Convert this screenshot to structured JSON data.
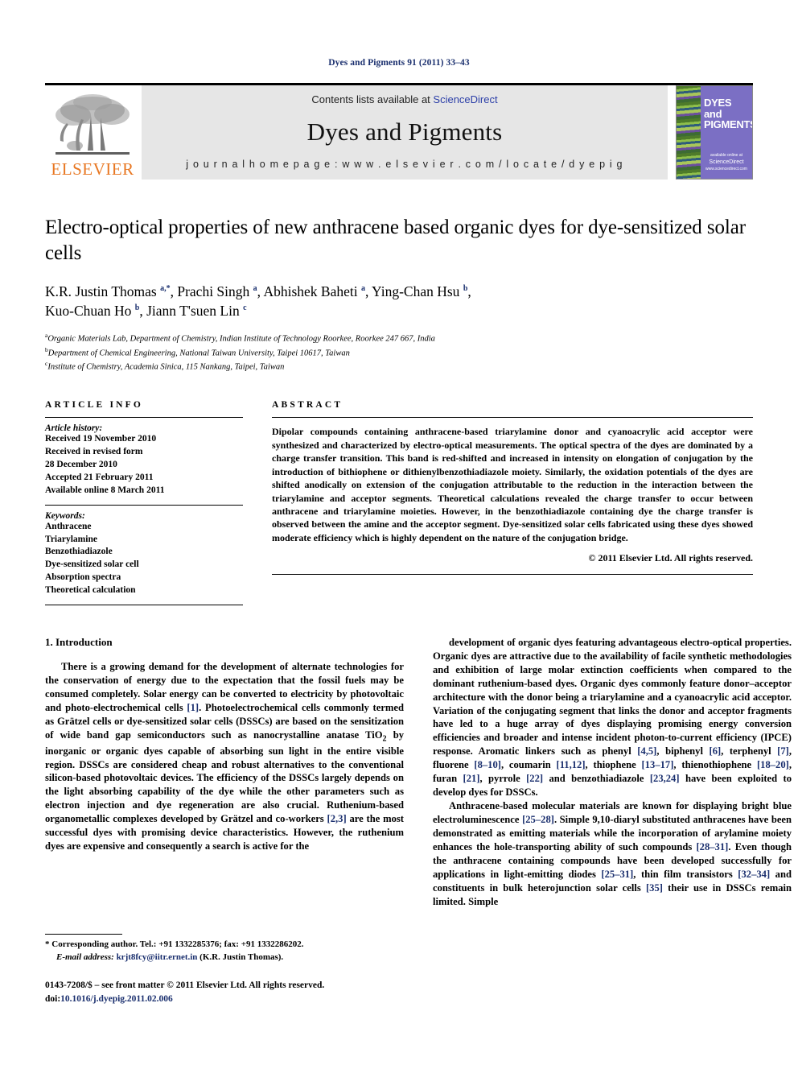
{
  "running_head": "Dyes and Pigments 91 (2011) 33–43",
  "masthead": {
    "publisher": "ELSEVIER",
    "contents_prefix": "Contents lists available at ",
    "contents_link": "ScienceDirect",
    "journal_title": "Dyes and Pigments",
    "homepage": "j o u r n a l   h o m e p a g e :   w w w . e l s e v i e r . c o m / l o c a t e / d y e p i g",
    "cover": {
      "line1": "DYES",
      "line2": "and",
      "line3": "PIGMENTS",
      "foot1": "available online at",
      "foot2": "ScienceDirect",
      "foot3": "www.sciencedirect.com",
      "bg_color": "#7b6fc4"
    }
  },
  "title": "Electro-optical properties of new anthracene based organic dyes for dye-sensitized solar cells",
  "authors_line1_html": "K.R. Justin Thomas <sup>a,*</sup>, Prachi Singh <sup>a</sup>, Abhishek Baheti <sup>a</sup>, Ying-Chan Hsu <sup>b</sup>,",
  "authors_line2_html": "Kuo-Chuan Ho <sup>b</sup>, Jiann T'suen Lin <sup>c</sup>",
  "affiliations": [
    {
      "mark": "a",
      "text": "Organic Materials Lab, Department of Chemistry, Indian Institute of Technology Roorkee, Roorkee 247 667, India"
    },
    {
      "mark": "b",
      "text": "Department of Chemical Engineering, National Taiwan University, Taipei 10617, Taiwan"
    },
    {
      "mark": "c",
      "text": "Institute of Chemistry, Academia Sinica, 115 Nankang, Taipei, Taiwan"
    }
  ],
  "article_info": {
    "heading": "ARTICLE INFO",
    "history_label": "Article history:",
    "history": [
      "Received 19 November 2010",
      "Received in revised form",
      "28 December 2010",
      "Accepted 21 February 2011",
      "Available online 8 March 2011"
    ],
    "keywords_label": "Keywords:",
    "keywords": [
      "Anthracene",
      "Triarylamine",
      "Benzothiadiazole",
      "Dye-sensitized solar cell",
      "Absorption spectra",
      "Theoretical calculation"
    ]
  },
  "abstract": {
    "heading": "ABSTRACT",
    "text": "Dipolar compounds containing anthracene-based triarylamine donor and cyanoacrylic acid acceptor were synthesized and characterized by electro-optical measurements. The optical spectra of the dyes are dominated by a charge transfer transition. This band is red-shifted and increased in intensity on elongation of conjugation by the introduction of bithiophene or dithienylbenzothiadiazole moiety. Similarly, the oxidation potentials of the dyes are shifted anodically on extension of the conjugation attributable to the reduction in the interaction between the triarylamine and acceptor segments. Theoretical calculations revealed the charge transfer to occur between anthracene and triarylamine moieties. However, in the benzothiadiazole containing dye the charge transfer is observed between the amine and the acceptor segment. Dye-sensitized solar cells fabricated using these dyes showed moderate efficiency which is highly dependent on the nature of the conjugation bridge.",
    "copyright": "© 2011 Elsevier Ltd. All rights reserved."
  },
  "body": {
    "section_number_title": "1. Introduction",
    "left_paragraph_1_html": "There is a growing demand for the development of alternate technologies for the conservation of energy due to the expectation that the fossil fuels may be consumed completely. Solar energy can be converted to electricity by photovoltaic and photo-electrochemical cells <span class=\"ref\">[1]</span>. Photoelectrochemical cells commonly termed as Gr&#228;tzel cells or dye-sensitized solar cells (DSSCs) are based on the sensitization of wide band gap semiconductors such as nanocrystalline anatase TiO<sub>2</sub> by inorganic or organic dyes capable of absorbing sun light in the entire visible region. DSSCs are considered cheap and robust alternatives to the conventional silicon-based photovoltaic devices. The efficiency of the DSSCs largely depends on the light absorbing capability of the dye while the other parameters such as electron injection and dye regeneration are also crucial. Ruthenium-based organometallic complexes developed by Gr&#228;tzel and co-workers <span class=\"ref\">[2,3]</span> are the most successful dyes with promising device characteristics. However, the ruthenium dyes are expensive and consequently a search is active for the",
    "right_paragraph_1_html": "development of organic dyes featuring advantageous electro-optical properties. Organic dyes are attractive due to the availability of facile synthetic methodologies and exhibition of large molar extinction coefficients when compared to the dominant ruthenium-based dyes. Organic dyes commonly feature donor&#8211;acceptor architecture with the donor being a triarylamine and a cyanoacrylic acid acceptor. Variation of the conjugating segment that links the donor and acceptor fragments have led to a huge array of dyes displaying promising energy conversion efficiencies and broader and intense incident photon-to-current efficiency (IPCE) response. Aromatic linkers such as phenyl <span class=\"ref\">[4,5]</span>, biphenyl <span class=\"ref\">[6]</span>, terphenyl <span class=\"ref\">[7]</span>, fluorene <span class=\"ref\">[8&#8211;10]</span>, coumarin <span class=\"ref\">[11,12]</span>, thiophene <span class=\"ref\">[13&#8211;17]</span>, thienothiophene <span class=\"ref\">[18&#8211;20]</span>, furan <span class=\"ref\">[21]</span>, pyrrole <span class=\"ref\">[22]</span> and benzothiadiazole <span class=\"ref\">[23,24]</span> have been exploited to develop dyes for DSSCs.",
    "right_paragraph_2_html": "Anthracene-based molecular materials are known for displaying bright blue electroluminescence <span class=\"ref\">[25&#8211;28]</span>. Simple 9,10-diaryl substituted anthracenes have been demonstrated as emitting materials while the incorporation of arylamine moiety enhances the hole-transporting ability of such compounds <span class=\"ref\">[28&#8211;31]</span>. Even though the anthracene containing compounds have been developed successfully for applications in light-emitting diodes <span class=\"ref\">[25&#8211;31]</span>, thin film transistors <span class=\"ref\">[32&#8211;34]</span> and constituents in bulk heterojunction solar cells <span class=\"ref\">[35]</span> their use in DSSCs remain limited. Simple"
  },
  "footnote": {
    "corresponding": "* Corresponding author. Tel.: +91 1332285376; fax: +91 1332286202.",
    "email_label": "E-mail address:",
    "email": "krjt8fcy@iitr.ernet.in",
    "email_owner": "(K.R. Justin Thomas)."
  },
  "imprint": {
    "line1": "0143-7208/$ – see front matter © 2011 Elsevier Ltd. All rights reserved.",
    "doi_label": "doi:",
    "doi_value": "10.1016/j.dyepig.2011.02.006"
  },
  "colors": {
    "link_blue": "#1a2f6e",
    "sciencedirect_blue": "#2c3fa8",
    "elsevier_orange": "#e87722",
    "masthead_grey": "#e6e6e6"
  }
}
